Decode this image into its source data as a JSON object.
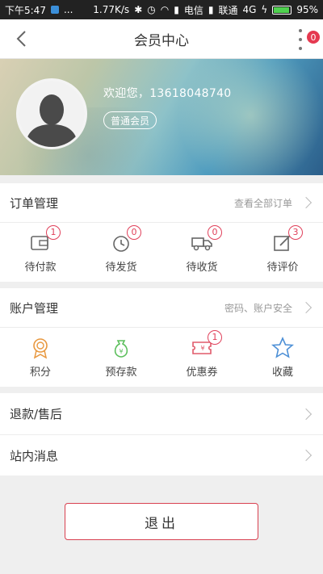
{
  "statusbar": {
    "time": "下午5:47",
    "dots": "...",
    "speed": "1.77K/s",
    "carrier1": "电信",
    "carrier2": "联通",
    "network": "4G",
    "battery": "95%",
    "battery_level": 0.95
  },
  "appbar": {
    "title": "会员中心",
    "more_badge": "0"
  },
  "profile": {
    "welcome": "欢迎您，13618048740",
    "member_level": "普通会员"
  },
  "orders": {
    "label": "订单管理",
    "hint": "查看全部订单",
    "items": [
      {
        "label": "待付款",
        "badge": "1",
        "icon": "wallet-icon"
      },
      {
        "label": "待发货",
        "badge": "0",
        "icon": "clock-icon"
      },
      {
        "label": "待收货",
        "badge": "0",
        "icon": "truck-icon"
      },
      {
        "label": "待评价",
        "badge": "3",
        "icon": "edit-icon"
      }
    ]
  },
  "account": {
    "label": "账户管理",
    "hint": "密码、账户安全",
    "items": [
      {
        "label": "积分",
        "icon": "medal-icon",
        "color": "#e8983f"
      },
      {
        "label": "预存款",
        "icon": "money-bag-icon",
        "color": "#5cbf5c"
      },
      {
        "label": "优惠券",
        "badge": "1",
        "icon": "coupon-icon",
        "color": "#e05a6a"
      },
      {
        "label": "收藏",
        "icon": "star-icon",
        "color": "#4c8fd6"
      }
    ]
  },
  "menu": {
    "refund": "退款/售后",
    "messages": "站内消息"
  },
  "logout_label": "退出"
}
